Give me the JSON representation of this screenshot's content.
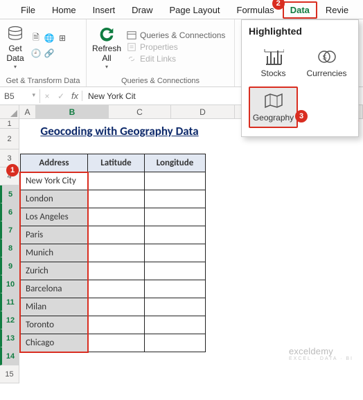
{
  "tabs": {
    "file": "File",
    "home": "Home",
    "insert": "Insert",
    "draw": "Draw",
    "pagelayout": "Page Layout",
    "formulas": "Formulas",
    "data": "Data",
    "review": "Revie"
  },
  "ribbon": {
    "getdata": {
      "label": "Get\nData",
      "group": "Get & Transform Data"
    },
    "refresh": {
      "label": "Refresh\nAll",
      "group": "Queries & Connections"
    },
    "queries": "Queries & Connections",
    "properties": "Properties",
    "editlinks": "Edit Links"
  },
  "popup": {
    "title": "Highlighted",
    "stocks": "Stocks",
    "currencies": "Currencies",
    "geography": "Geography"
  },
  "fx": {
    "namebox": "B5",
    "value": "New York Cit"
  },
  "sheet": {
    "title": "Geocoding with Geography Data",
    "headers": {
      "address": "Address",
      "lat": "Latitude",
      "lon": "Longitude"
    },
    "rows": [
      "New York City",
      "London",
      "Los Angeles",
      "Paris",
      "Munich",
      "Zurich",
      "Barcelona",
      "Milan",
      "Toronto",
      "Chicago"
    ]
  },
  "cols": [
    "A",
    "B",
    "C",
    "D"
  ],
  "watermark": {
    "main": "exceldemy",
    "sub": "EXCEL · DATA · BI"
  },
  "callouts": {
    "c1": "1",
    "c2": "2",
    "c3": "3"
  }
}
